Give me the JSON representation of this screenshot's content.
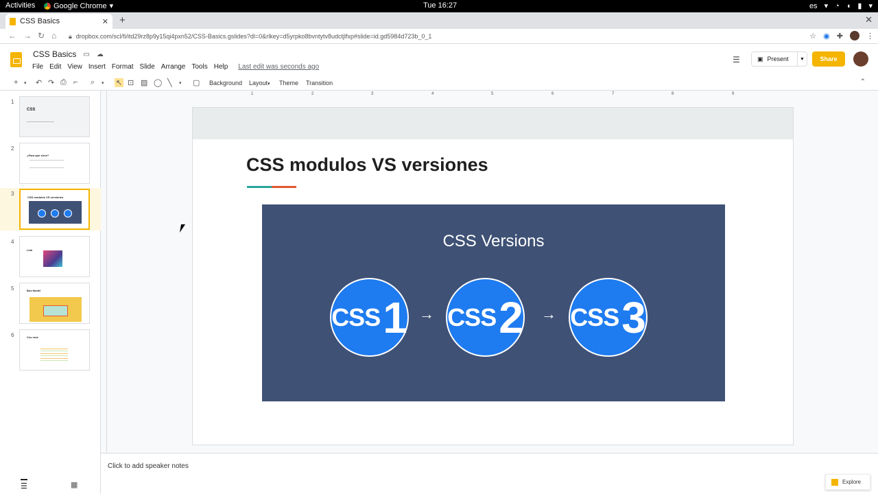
{
  "os": {
    "activities": "Activities",
    "app": "Google Chrome",
    "clock": "Tue 16:27",
    "lang": "es"
  },
  "browser": {
    "tab_title": "CSS Basics",
    "url": "dropbox.com/scl/fi/itd29rz8p9y15qi4pxn52/CSS-Basics.gslides?dl=0&rlkey=d5yrpko8bvntytv8udctjlfxp#slide=id.gd5984d723b_0_1"
  },
  "app": {
    "doc_title": "CSS Basics",
    "menus": [
      "File",
      "Edit",
      "View",
      "Insert",
      "Format",
      "Slide",
      "Arrange",
      "Tools",
      "Help"
    ],
    "last_edit": "Last edit was seconds ago",
    "present_label": "Present",
    "share_label": "Share"
  },
  "toolbar": {
    "background": "Background",
    "layout": "Layout",
    "theme": "Theme",
    "transition": "Transition"
  },
  "slides": [
    {
      "num": "1",
      "title": "CSS"
    },
    {
      "num": "2",
      "title": "¿Para qué sirve?"
    },
    {
      "num": "3",
      "title": "CSS modulos VS versiones"
    },
    {
      "num": "4",
      "title": "Link"
    },
    {
      "num": "5",
      "title": "Box Model"
    },
    {
      "num": "6",
      "title": "Css reúz"
    }
  ],
  "current_slide": {
    "title": "CSS modulos VS versiones",
    "image_heading": "CSS Versions",
    "badges": [
      {
        "label": "CSS",
        "num": "1"
      },
      {
        "label": "CSS",
        "num": "2"
      },
      {
        "label": "CSS",
        "num": "3"
      }
    ],
    "arrow": "→"
  },
  "ruler": [
    "1",
    "2",
    "3",
    "4",
    "5",
    "6",
    "7",
    "8",
    "9"
  ],
  "notes": {
    "placeholder": "Click to add speaker notes"
  },
  "explore_label": "Explore",
  "colors": {
    "accent": "#f4b400",
    "panel": "#3f5175",
    "badge": "#1e7bf0",
    "teal": "#26a69a",
    "orange": "#e4572e"
  }
}
